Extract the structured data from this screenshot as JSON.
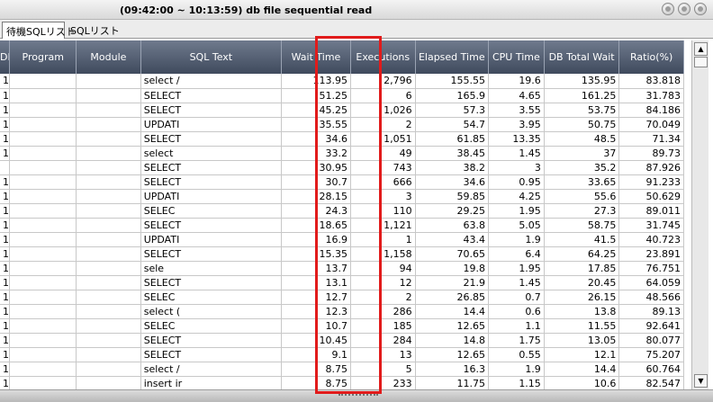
{
  "window": {
    "title": "(09:42:00 ~ 10:13:59) db file sequential read"
  },
  "tabs": [
    {
      "label": "待機SQLリスト"
    },
    {
      "label": "SQLリスト"
    }
  ],
  "table": {
    "columns": [
      "DB User",
      "Program",
      "Module",
      "SQL Text",
      "Wait Time",
      "Executions",
      "Elapsed Time",
      "CPU Time",
      "DB Total Wait",
      "Ratio(%)"
    ],
    "rows": [
      [
        "1",
        "",
        "",
        "select /",
        "113.95",
        "2,796",
        "155.55",
        "19.6",
        "135.95",
        "83.818"
      ],
      [
        "1",
        "",
        "",
        "SELECT",
        "51.25",
        "6",
        "165.9",
        "4.65",
        "161.25",
        "31.783"
      ],
      [
        "1",
        "",
        "",
        "SELECT",
        "45.25",
        "1,026",
        "57.3",
        "3.55",
        "53.75",
        "84.186"
      ],
      [
        "1",
        "",
        "",
        "UPDATI",
        "35.55",
        "2",
        "54.7",
        "3.95",
        "50.75",
        "70.049"
      ],
      [
        "1",
        "",
        "",
        "SELECT",
        "34.6",
        "1,051",
        "61.85",
        "13.35",
        "48.5",
        "71.34"
      ],
      [
        "1",
        "",
        "",
        "select",
        "33.2",
        "49",
        "38.45",
        "1.45",
        "37",
        "89.73"
      ],
      [
        "",
        "",
        "",
        "SELECT",
        "30.95",
        "743",
        "38.2",
        "3",
        "35.2",
        "87.926"
      ],
      [
        "1",
        "",
        "",
        "SELECT",
        "30.7",
        "666",
        "34.6",
        "0.95",
        "33.65",
        "91.233"
      ],
      [
        "1",
        "",
        "",
        "UPDATI",
        "28.15",
        "3",
        "59.85",
        "4.25",
        "55.6",
        "50.629"
      ],
      [
        "1",
        "",
        "",
        "SELEC",
        "24.3",
        "110",
        "29.25",
        "1.95",
        "27.3",
        "89.011"
      ],
      [
        "1",
        "",
        "",
        "SELECT",
        "18.65",
        "1,121",
        "63.8",
        "5.05",
        "58.75",
        "31.745"
      ],
      [
        "1",
        "",
        "",
        "UPDATI",
        "16.9",
        "1",
        "43.4",
        "1.9",
        "41.5",
        "40.723"
      ],
      [
        "1",
        "",
        "",
        "SELECT",
        "15.35",
        "1,158",
        "70.65",
        "6.4",
        "64.25",
        "23.891"
      ],
      [
        "1",
        "",
        "",
        "sele",
        "13.7",
        "94",
        "19.8",
        "1.95",
        "17.85",
        "76.751"
      ],
      [
        "1",
        "",
        "",
        "SELECT",
        "13.1",
        "12",
        "21.9",
        "1.45",
        "20.45",
        "64.059"
      ],
      [
        "1",
        "",
        "",
        "SELEC",
        "12.7",
        "2",
        "26.85",
        "0.7",
        "26.15",
        "48.566"
      ],
      [
        "1",
        "",
        "",
        "select (",
        "12.3",
        "286",
        "14.4",
        "0.6",
        "13.8",
        "89.13"
      ],
      [
        "1",
        "",
        "",
        "SELEC",
        "10.7",
        "185",
        "12.65",
        "1.1",
        "11.55",
        "92.641"
      ],
      [
        "1",
        "",
        "",
        "SELECT",
        "10.45",
        "284",
        "14.8",
        "1.75",
        "13.05",
        "80.077"
      ],
      [
        "1",
        "",
        "",
        "SELECT",
        "9.1",
        "13",
        "12.65",
        "0.55",
        "12.1",
        "75.207"
      ],
      [
        "1",
        "",
        "",
        "select /",
        "8.75",
        "5",
        "16.3",
        "1.9",
        "14.4",
        "60.764"
      ],
      [
        "1",
        "",
        "",
        "insert ir",
        "8.75",
        "233",
        "11.75",
        "1.15",
        "10.6",
        "82.547"
      ]
    ]
  },
  "colors": {
    "header_bg": "#4f5a6d",
    "highlight": "#e11b1b"
  }
}
